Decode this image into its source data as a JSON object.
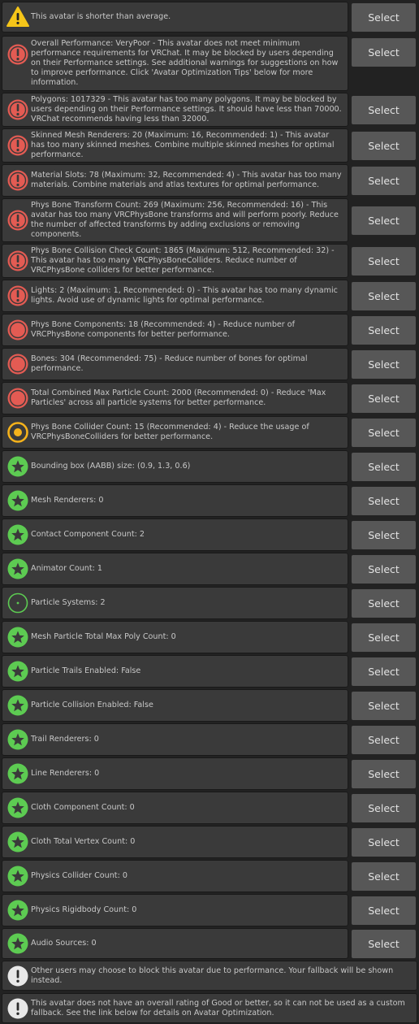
{
  "button_label": "Select",
  "colors": {
    "warning": "#f5c519",
    "very_poor": "#e35b53",
    "poor": "#e35b53",
    "medium": "#f5b21b",
    "good": "#5dcb52",
    "info": "#e8e8e8"
  },
  "items": [
    {
      "icon": "warning-icon",
      "text": "This avatar is shorter than average."
    },
    {
      "icon": "very-poor-rating-icon",
      "text": "Overall Performance: VeryPoor - This avatar does not meet minimum performance requirements for VRChat. It may be blocked by users depending on their Performance settings. See additional warnings for suggestions on how to improve performance. Click 'Avatar Optimization Tips' below for more information."
    },
    {
      "icon": "very-poor-rating-icon",
      "text": "Polygons: 1017329 - This avatar has too many polygons. It may be blocked by users depending on their Performance settings. It should have less than 70000. VRChat recommends having less than 32000."
    },
    {
      "icon": "very-poor-rating-icon",
      "text": "Skinned Mesh Renderers: 20 (Maximum: 16, Recommended: 1) - This avatar has too many skinned meshes. Combine multiple skinned meshes for optimal performance."
    },
    {
      "icon": "very-poor-rating-icon",
      "text": "Material Slots: 78 (Maximum: 32, Recommended: 4) - This avatar has too many materials. Combine materials and atlas textures for optimal performance."
    },
    {
      "icon": "very-poor-rating-icon",
      "text": "Phys Bone Transform Count: 269 (Maximum: 256, Recommended: 16) - This avatar has too many VRCPhysBone transforms and will perform poorly. Reduce the number of affected transforms by adding exclusions or removing components."
    },
    {
      "icon": "very-poor-rating-icon",
      "text": "Phys Bone Collision Check Count: 1865 (Maximum: 512, Recommended: 32) - This avatar has too many VRCPhysBoneColliders. Reduce number of VRCPhysBone colliders for better performance."
    },
    {
      "icon": "very-poor-rating-icon",
      "text": "Lights: 2 (Maximum: 1, Recommended: 0) - This avatar has too many dynamic lights. Avoid use of dynamic lights for optimal performance."
    },
    {
      "icon": "poor-rating-icon",
      "text": "Phys Bone Components: 18 (Recommended: 4) - Reduce number of VRCPhysBone components for better performance."
    },
    {
      "icon": "poor-rating-icon",
      "text": "Bones: 304 (Recommended: 75) - Reduce number of bones for optimal performance."
    },
    {
      "icon": "poor-rating-icon",
      "text": "Total Combined Max Particle Count: 2000 (Recommended: 0) - Reduce 'Max Particles' across all particle systems for better performance."
    },
    {
      "icon": "medium-rating-icon",
      "text": "Phys Bone Collider Count: 15 (Recommended: 4) - Reduce the usage of VRCPhysBoneColliders for better performance."
    },
    {
      "icon": "excellent-star-icon",
      "text": "Bounding box (AABB) size: (0.9, 1.3, 0.6)"
    },
    {
      "icon": "excellent-star-icon",
      "text": "Mesh Renderers: 0"
    },
    {
      "icon": "excellent-star-icon",
      "text": "Contact Component Count: 2"
    },
    {
      "icon": "excellent-star-icon",
      "text": "Animator Count: 1"
    },
    {
      "icon": "good-rating-icon",
      "text": "Particle Systems: 2"
    },
    {
      "icon": "excellent-star-icon",
      "text": "Mesh Particle Total Max Poly Count: 0"
    },
    {
      "icon": "excellent-star-icon",
      "text": "Particle Trails Enabled: False"
    },
    {
      "icon": "excellent-star-icon",
      "text": "Particle Collision Enabled: False"
    },
    {
      "icon": "excellent-star-icon",
      "text": "Trail Renderers: 0"
    },
    {
      "icon": "excellent-star-icon",
      "text": "Line Renderers: 0"
    },
    {
      "icon": "excellent-star-icon",
      "text": "Cloth Component Count: 0"
    },
    {
      "icon": "excellent-star-icon",
      "text": "Cloth Total Vertex Count: 0"
    },
    {
      "icon": "excellent-star-icon",
      "text": "Physics Collider Count: 0"
    },
    {
      "icon": "excellent-star-icon",
      "text": "Physics Rigidbody Count: 0"
    },
    {
      "icon": "excellent-star-icon",
      "text": "Audio Sources: 0"
    }
  ],
  "notices": [
    {
      "icon": "info-icon",
      "text": "Other users may choose to block this avatar due to performance. Your fallback will be shown instead."
    },
    {
      "icon": "info-icon",
      "text": "This avatar does not have an overall rating of Good or better, so it can not be used as a custom fallback. See the link below for details on Avatar Optimization."
    }
  ]
}
